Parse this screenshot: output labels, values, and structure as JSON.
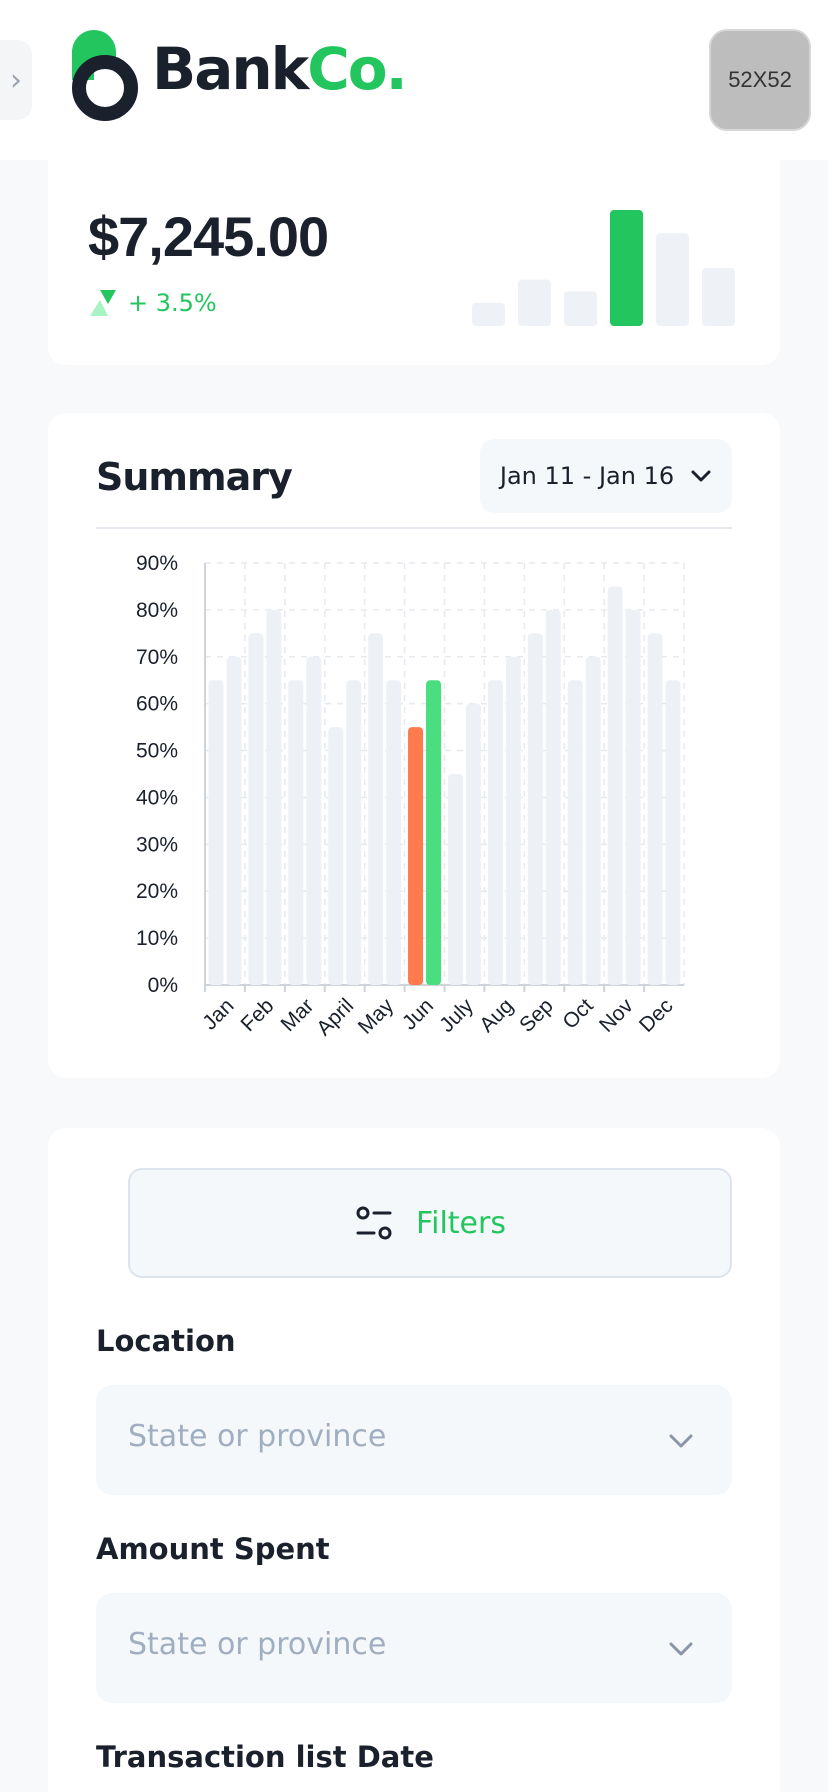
{
  "header": {
    "logo_bank": "Bank",
    "logo_co": "Co.",
    "avatar_text": "52X52",
    "sidebar_toggle_icon": "chevron-right-icon"
  },
  "balance": {
    "value": "$7,245.00",
    "change": "+ 3.5%",
    "trend_icon": "trend-up-icon",
    "mini_chart_values": [
      2,
      4,
      3,
      10,
      8,
      5
    ],
    "mini_chart_highlight_index": 3
  },
  "summary": {
    "title": "Summary",
    "date_range": "Jan 11 - Jan 16",
    "date_icon": "chevron-down-icon"
  },
  "chart_data": {
    "type": "bar",
    "categories": [
      "Jan",
      "Feb",
      "Mar",
      "April",
      "May",
      "Jun",
      "July",
      "Aug",
      "Sep",
      "Oct",
      "Nov",
      "Dec"
    ],
    "series": [
      {
        "values": [
          65,
          75,
          65,
          55,
          75,
          55,
          45,
          65,
          75,
          65,
          85,
          75
        ]
      },
      {
        "values": [
          70,
          80,
          70,
          65,
          65,
          65,
          60,
          70,
          80,
          70,
          80,
          65
        ]
      }
    ],
    "highlight_category": "Jun",
    "ylim": [
      0,
      90
    ],
    "yticks": [
      "0%",
      "10%",
      "20%",
      "30%",
      "40%",
      "50%",
      "60%",
      "70%",
      "80%",
      "90%"
    ],
    "grid": true,
    "colors": {
      "muted": "#edf1f5",
      "highlight_a": "#ff7a4d",
      "highlight_b": "#4ade80"
    }
  },
  "filters": {
    "button_label": "Filters",
    "button_icon": "sliders-icon",
    "fields": [
      {
        "label": "Location",
        "placeholder": "State or province"
      },
      {
        "label": "Amount Spent",
        "placeholder": "State or province"
      },
      {
        "label": "Transaction list Date"
      }
    ]
  },
  "colors": {
    "brand": "#22c55e",
    "text": "#1a202c",
    "muted_text": "#a0aec0",
    "background": "#f8f9fa"
  }
}
